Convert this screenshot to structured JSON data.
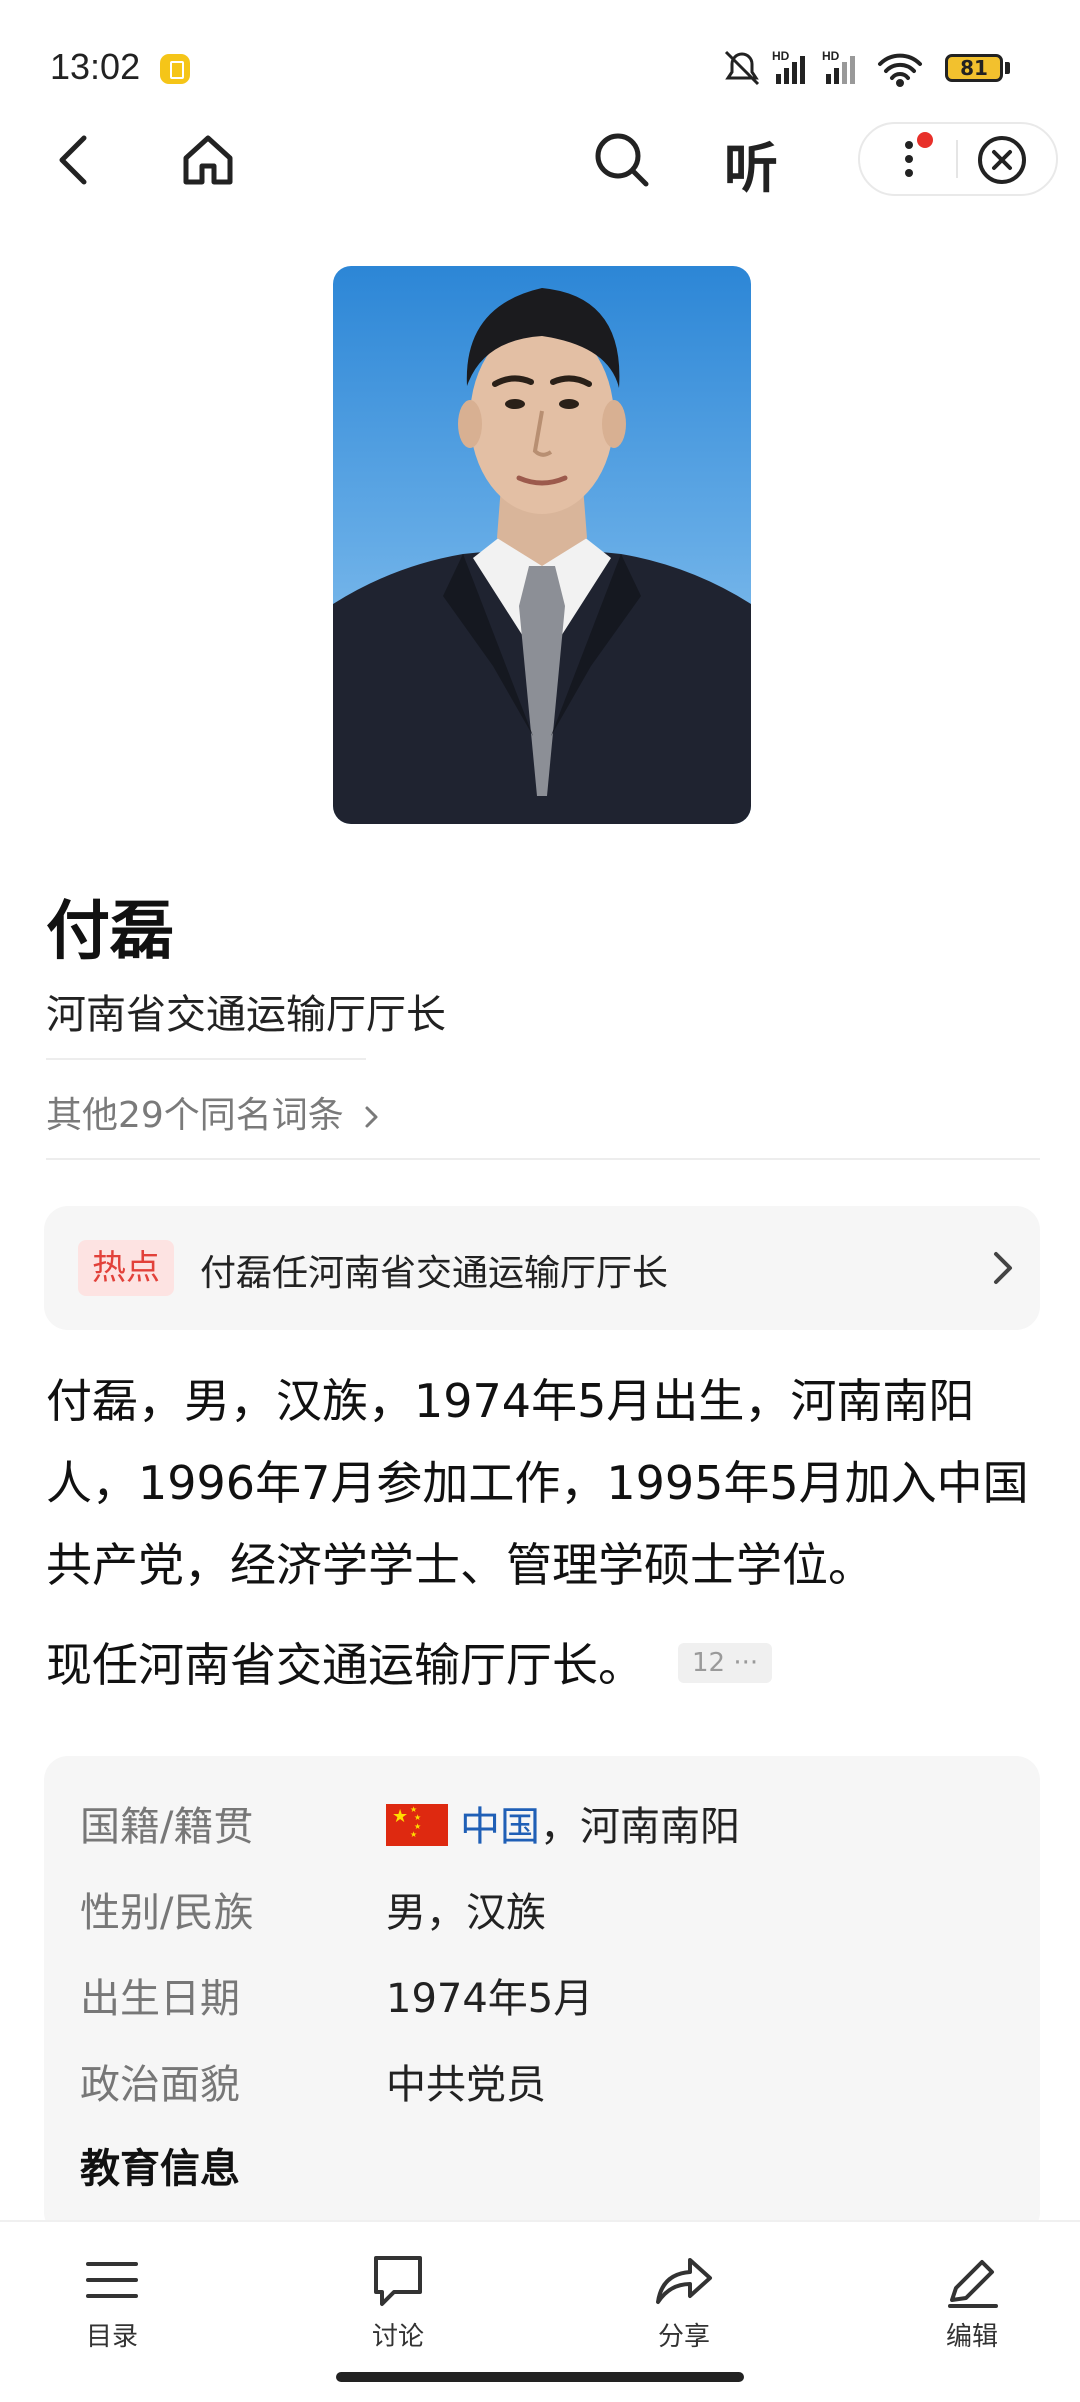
{
  "status_bar": {
    "time": "13:02",
    "battery": "81"
  },
  "nav": {
    "listen_label": "听"
  },
  "entry": {
    "name": "付磊",
    "subtitle": "河南省交通运输厅厅长",
    "same_name_link": "其他29个同名词条",
    "hot_tag": "热点",
    "hot_text": "付磊任河南省交通运输厅厅长",
    "summary": "付磊，男，汉族，1974年5月出生，河南南阳人，1996年7月参加工作，1995年5月加入中国共产党，经济学学士、管理学硕士学位。",
    "current_role": "现任河南省交通运输厅厅长。",
    "citation": "12 ···"
  },
  "info": {
    "rows": [
      {
        "label": "国籍/籍贯",
        "value_link": "中国",
        "value_rest": "，河南南阳"
      },
      {
        "label": "性别/民族",
        "value": "男，汉族"
      },
      {
        "label": "出生日期",
        "value": "1974年5月"
      },
      {
        "label": "政治面貌",
        "value": "中共党员"
      }
    ],
    "section_heading": "教育信息"
  },
  "bottom_tabs": [
    {
      "label": "目录",
      "icon": "list-icon"
    },
    {
      "label": "讨论",
      "icon": "chat-bubble-icon"
    },
    {
      "label": "分享",
      "icon": "share-arrow-icon"
    },
    {
      "label": "编辑",
      "icon": "pen-icon"
    }
  ],
  "colors": {
    "hot_tag_bg": "#fde3e2",
    "hot_tag_text": "#e2413a",
    "link": "#1f5fb6",
    "card_bg": "#f6f6f6",
    "notify_dot": "#e8302a"
  }
}
